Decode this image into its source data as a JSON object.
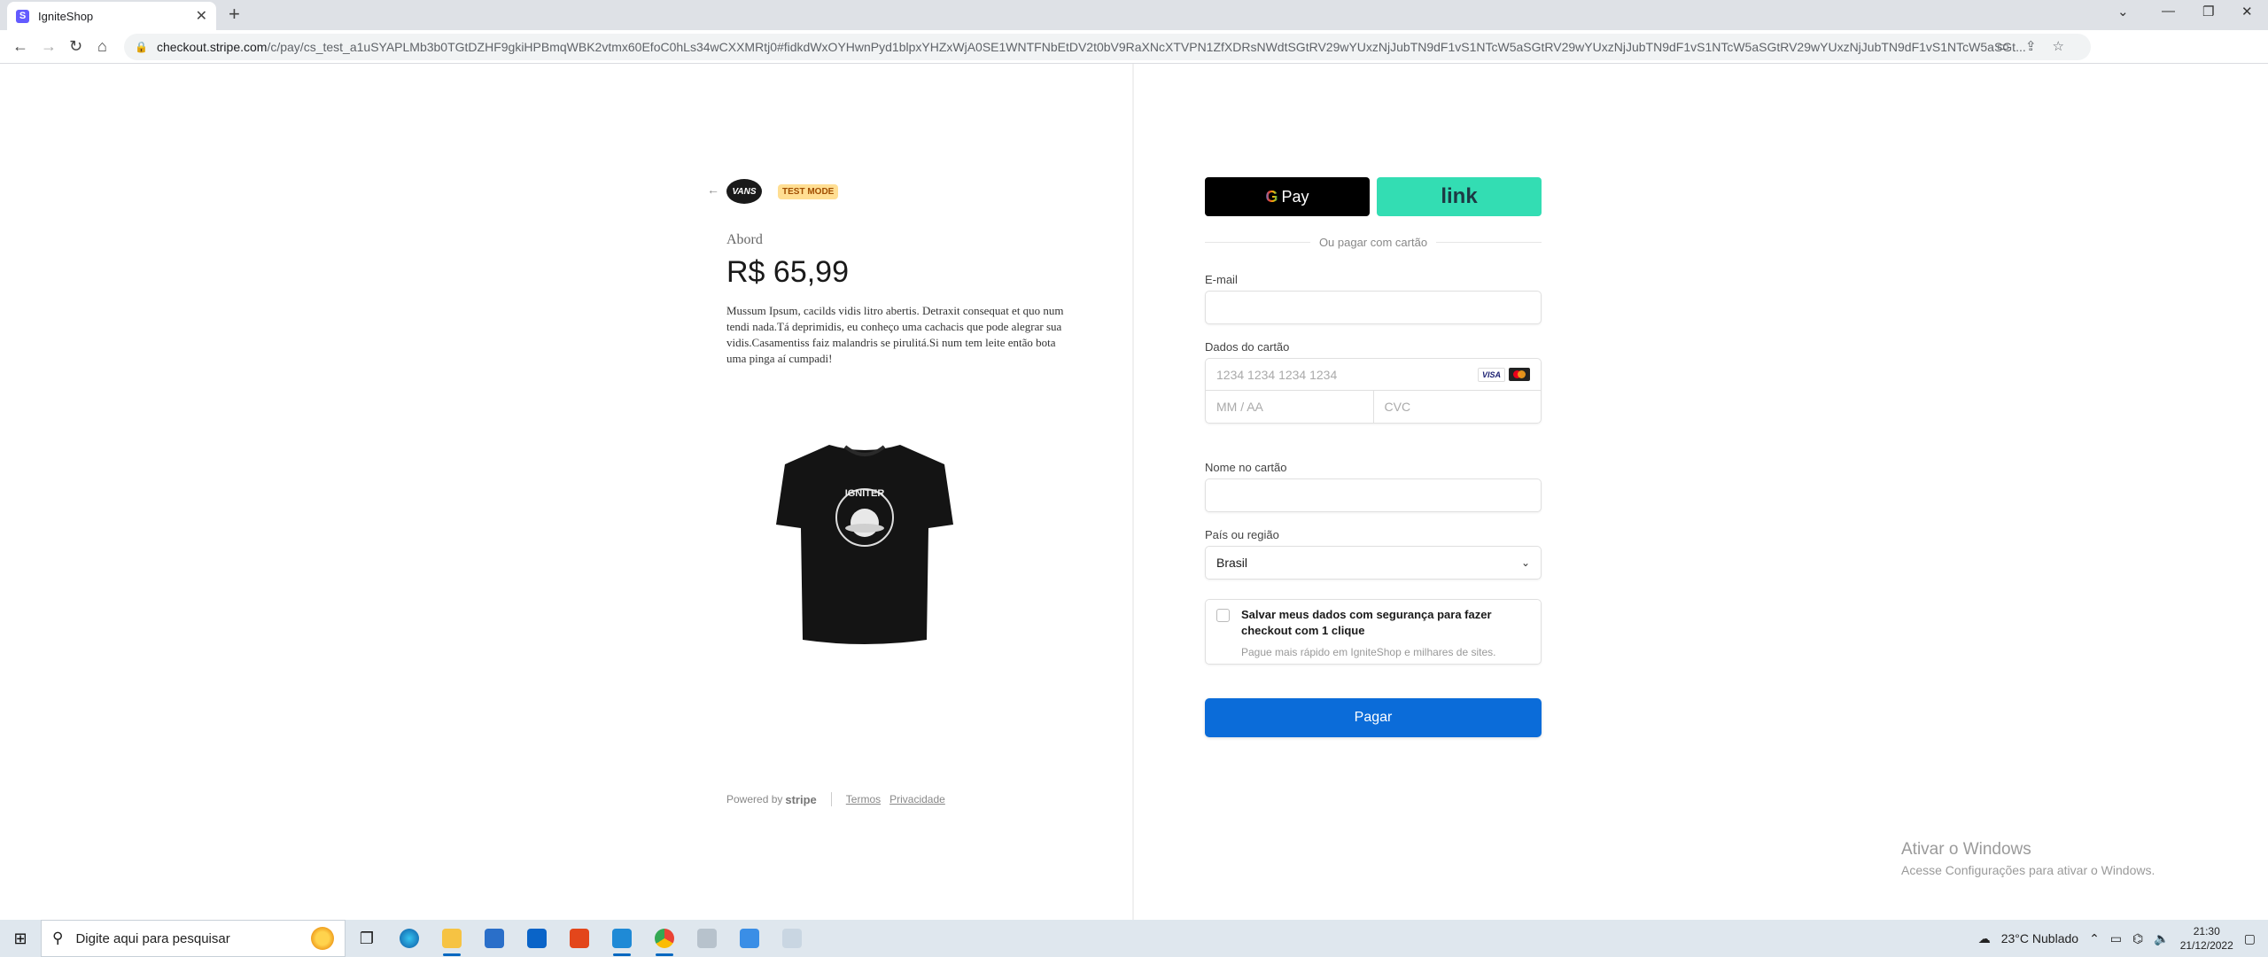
{
  "browser": {
    "tab_title": "IgniteShop",
    "favicon_letter": "S",
    "url_domain": "checkout.stripe.com",
    "url_path": "/c/pay/cs_test_a1uSYAPLMb3b0TGtDZHF9gkiHPBmqWBK2vtmx60EfoC0hLs34wCXXMRtj0#fidkdWxOYHwnPyd1blpxYHZxWjA0SE1WNTFNbEtDV2t0bV9RaXNcXTVPN1ZfXDRsNWdtSGtRV29wYUxzNjJubTN9dF1vS1NTcW5aSGtRV29wYUxzNjJubTN9dF1vS1NTcW5aSGtRV29wYUxzNjJubTN9dF1vS1NTcW5aSGt..."
  },
  "merchant": {
    "logo_text": "VANS",
    "test_mode": "TEST MODE"
  },
  "product": {
    "name": "Abord",
    "price": "R$ 65,99",
    "description": "Mussum Ipsum, cacilds vidis litro abertis. Detraxit consequat et quo num tendi nada.Tá deprimidis, eu conheço uma cachacis que pode alegrar sua vidis.Casamentiss faiz malandris se pirulitá.Si num tem leite então bota uma pinga aí cumpadi!",
    "shirt_print": "IGNITER"
  },
  "footer": {
    "powered_by": "Powered by",
    "stripe": "stripe",
    "terms": "Termos",
    "privacy": "Privacidade"
  },
  "checkout": {
    "gpay_label": "Pay",
    "link_label": "link",
    "or_text": "Ou pagar com cartão",
    "email_label": "E-mail",
    "card_label": "Dados do cartão",
    "card_number_placeholder": "1234 1234 1234 1234",
    "visa": "VISA",
    "expiry_placeholder": "MM / AA",
    "cvc_placeholder": "CVC",
    "name_label": "Nome no cartão",
    "country_label": "País ou região",
    "country_value": "Brasil",
    "save_title": "Salvar meus dados com segurança para fazer checkout com 1 clique",
    "save_sub": "Pague mais rápido em IgniteShop e milhares de sites.",
    "pay_button": "Pagar"
  },
  "watermark": {
    "line1": "Ativar o Windows",
    "line2": "Acesse Configurações para ativar o Windows."
  },
  "taskbar": {
    "search_placeholder": "Digite aqui para pesquisar",
    "weather": "23°C  Nublado",
    "time": "21:30",
    "date": "21/12/2022"
  }
}
